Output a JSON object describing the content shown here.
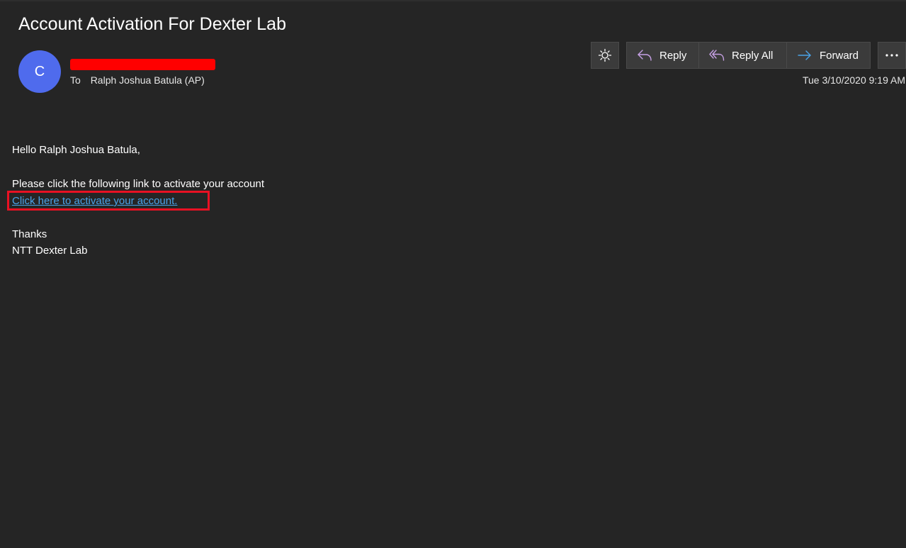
{
  "email": {
    "subject": "Account Activation For Dexter Lab",
    "avatar_initial": "C",
    "to_label": "To",
    "recipient": "Ralph Joshua Batula (AP)",
    "date": "Tue 3/10/2020 9:19 AM"
  },
  "toolbar": {
    "theme_icon": "sun-icon",
    "reply_label": "Reply",
    "reply_all_label": "Reply All",
    "forward_label": "Forward",
    "more_icon": "more-options-icon"
  },
  "body": {
    "greeting": "Hello Ralph Joshua Batula,",
    "instruction": "Please click the following link to activate your account",
    "link_text": "Click here to activate your account.",
    "thanks": "Thanks",
    "signature": "NTT Dexter Lab"
  },
  "colors": {
    "background": "#252525",
    "avatar": "#4f6bed",
    "link": "#4aa3e8",
    "reply_icon": "#c8a2e6",
    "forward_icon": "#4aa3e8",
    "highlight": "#e81123",
    "redaction": "#ff0000"
  }
}
